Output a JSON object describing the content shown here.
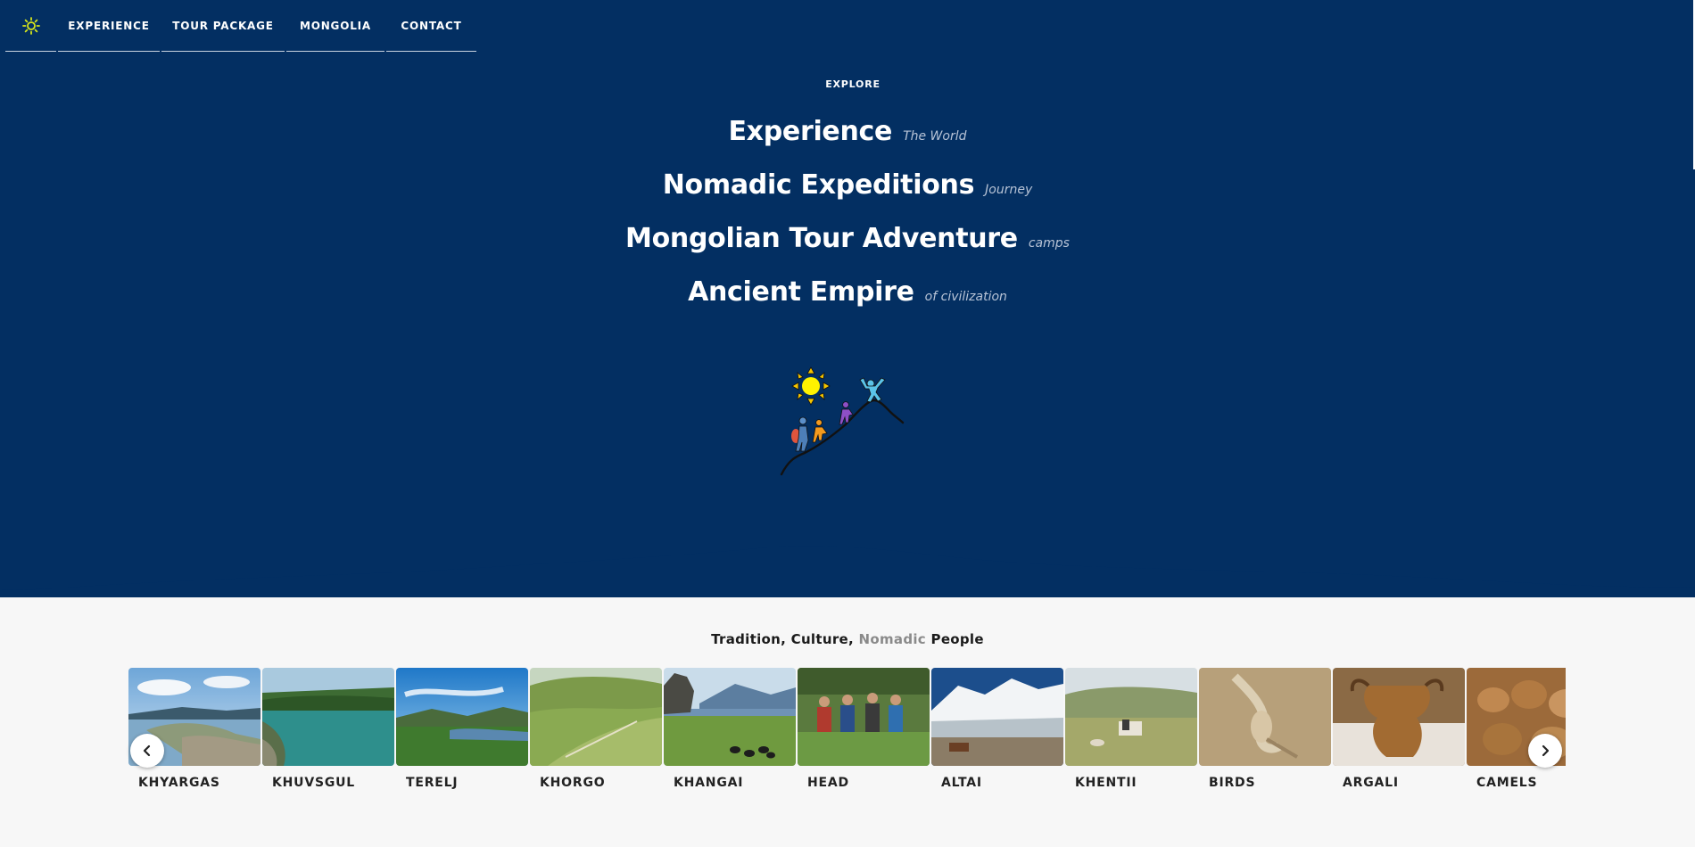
{
  "nav": {
    "logo_icon": "sun-icon",
    "items": [
      {
        "label": "EXPERIENCE"
      },
      {
        "label": "TOUR PACKAGE"
      },
      {
        "label": "MONGOLIA"
      },
      {
        "label": "CONTACT"
      }
    ]
  },
  "hero": {
    "eyebrow": "EXPLORE",
    "headlines": [
      {
        "big": "Experience",
        "small": "The World"
      },
      {
        "big": "Nomadic Expeditions",
        "small": "Journey"
      },
      {
        "big": "Mongolian Tour Adventure",
        "small": "camps"
      },
      {
        "big": "Ancient Empire",
        "small": "of civilization"
      }
    ],
    "illustration_icon": "hikers-mountain-sun-illustration"
  },
  "tagline": {
    "part1": "Tradition, Culture, ",
    "highlight": "Nomadic",
    "part2": " People"
  },
  "gallery": {
    "items": [
      {
        "label": "KHYARGAS"
      },
      {
        "label": "KHUVSGUL"
      },
      {
        "label": "TERELJ"
      },
      {
        "label": "KHORGO"
      },
      {
        "label": "KHANGAI"
      },
      {
        "label": "HEAD"
      },
      {
        "label": "ALTAI"
      },
      {
        "label": "KHENTII"
      },
      {
        "label": "BIRDS"
      },
      {
        "label": "ARGALI"
      },
      {
        "label": "CAMELS"
      }
    ],
    "prev_icon": "chevron-left-icon",
    "next_icon": "chevron-right-icon"
  },
  "colors": {
    "hero_bg": "#032f62",
    "muted_text": "#b7c3d6",
    "highlight": "#8a8a8a",
    "logo_sun": "#d7e61a"
  }
}
